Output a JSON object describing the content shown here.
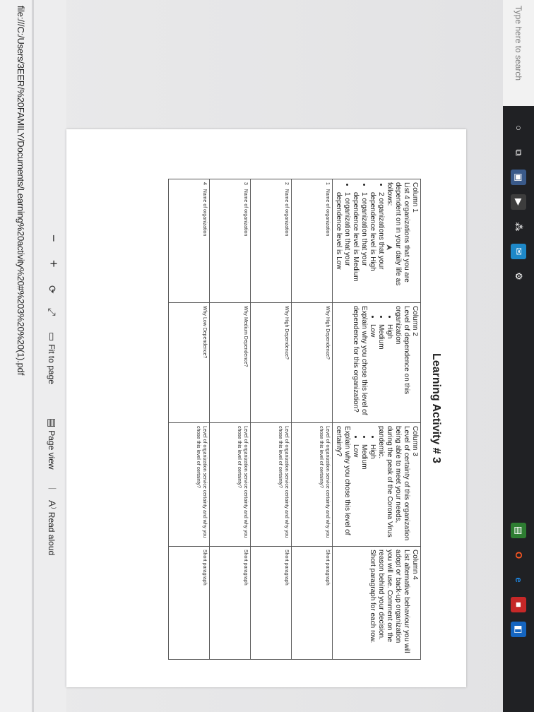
{
  "browser": {
    "url_text": "file:///C:/Users/3EER/%20FAMILY/Documents/Learning%20activity%20#%203%20%20(1).pdf",
    "zoom_out": "−",
    "zoom_in": "+",
    "fit_to_page_label": "Fit to page",
    "page_view_label": "Page view",
    "read_aloud_label": "Read aloud"
  },
  "taskbar": {
    "search_placeholder": "Type here to search"
  },
  "document": {
    "title": "Learning Activity # 3",
    "header_row": {
      "col1": {
        "head": "Column 1",
        "intro": "List 4 organizations that you are dependent on in your daily life as follows:",
        "b1": "2 organizations that your dependence level is High",
        "b2": "1 organization that your dependence level is Medium",
        "b3": "1 organization that your dependence level is Low"
      },
      "col2": {
        "head": "Column 2",
        "intro": "Level of dependence on this organization",
        "o1": "High",
        "o2": "Medium",
        "o3": "Low",
        "explain": "Explain why you chose this level of dependence for this organization?"
      },
      "col3": {
        "head": "Column 3",
        "intro": "Level of certainty of this organization being able to meet your needs, during the peak of the Corona Virus pandemic.",
        "o1": "High",
        "o2": "Medium",
        "o3": "Low",
        "explain": "Explain why you chose this level of certainty?"
      },
      "col4": {
        "head": "Column 4",
        "text": "List alternative behaviour you will adopt or back-up organization you will use. Comment on the reason behind your decision. Short paragraph for each row."
      }
    },
    "rows": [
      {
        "n": "1",
        "c1": "Name of organization",
        "c2": "Why High Dependence?",
        "c3": "Level of organization service certainty and why you chose this level of certainty?",
        "c4": "Short paragraph"
      },
      {
        "n": "2",
        "c1": "Name of organization",
        "c2": "Why High Dependence?",
        "c3": "Level of organization service certainty and why you chose this level of certainty?",
        "c4": "Short paragraph"
      },
      {
        "n": "3",
        "c1": "Name of organization",
        "c2": "Why Medium Dependence?",
        "c3": "Level of organization service certainty and why you chose this level of certainty?",
        "c4": "Short paragraph"
      },
      {
        "n": "4",
        "c1": "Name of organization",
        "c2": "Why Low Dependence?",
        "c3": "Level of organization service certainty and why you chose this level of certainty?",
        "c4": "Short paragraph"
      }
    ]
  }
}
